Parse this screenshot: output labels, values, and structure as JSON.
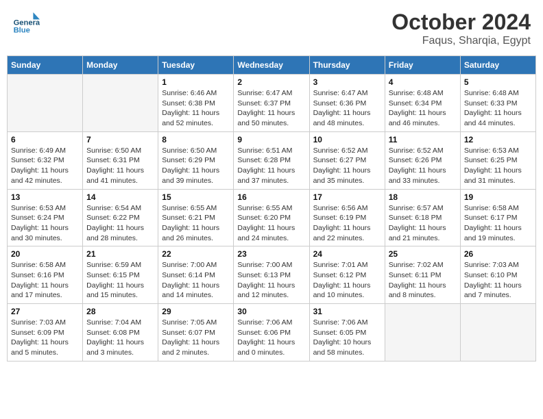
{
  "header": {
    "logo_line1": "General",
    "logo_line2": "Blue",
    "title": "October 2024",
    "subtitle": "Faqus, Sharqia, Egypt"
  },
  "days_of_week": [
    "Sunday",
    "Monday",
    "Tuesday",
    "Wednesday",
    "Thursday",
    "Friday",
    "Saturday"
  ],
  "weeks": [
    [
      {
        "day": "",
        "detail": ""
      },
      {
        "day": "",
        "detail": ""
      },
      {
        "day": "1",
        "detail": "Sunrise: 6:46 AM\nSunset: 6:38 PM\nDaylight: 11 hours\nand 52 minutes."
      },
      {
        "day": "2",
        "detail": "Sunrise: 6:47 AM\nSunset: 6:37 PM\nDaylight: 11 hours\nand 50 minutes."
      },
      {
        "day": "3",
        "detail": "Sunrise: 6:47 AM\nSunset: 6:36 PM\nDaylight: 11 hours\nand 48 minutes."
      },
      {
        "day": "4",
        "detail": "Sunrise: 6:48 AM\nSunset: 6:34 PM\nDaylight: 11 hours\nand 46 minutes."
      },
      {
        "day": "5",
        "detail": "Sunrise: 6:48 AM\nSunset: 6:33 PM\nDaylight: 11 hours\nand 44 minutes."
      }
    ],
    [
      {
        "day": "6",
        "detail": "Sunrise: 6:49 AM\nSunset: 6:32 PM\nDaylight: 11 hours\nand 42 minutes."
      },
      {
        "day": "7",
        "detail": "Sunrise: 6:50 AM\nSunset: 6:31 PM\nDaylight: 11 hours\nand 41 minutes."
      },
      {
        "day": "8",
        "detail": "Sunrise: 6:50 AM\nSunset: 6:29 PM\nDaylight: 11 hours\nand 39 minutes."
      },
      {
        "day": "9",
        "detail": "Sunrise: 6:51 AM\nSunset: 6:28 PM\nDaylight: 11 hours\nand 37 minutes."
      },
      {
        "day": "10",
        "detail": "Sunrise: 6:52 AM\nSunset: 6:27 PM\nDaylight: 11 hours\nand 35 minutes."
      },
      {
        "day": "11",
        "detail": "Sunrise: 6:52 AM\nSunset: 6:26 PM\nDaylight: 11 hours\nand 33 minutes."
      },
      {
        "day": "12",
        "detail": "Sunrise: 6:53 AM\nSunset: 6:25 PM\nDaylight: 11 hours\nand 31 minutes."
      }
    ],
    [
      {
        "day": "13",
        "detail": "Sunrise: 6:53 AM\nSunset: 6:24 PM\nDaylight: 11 hours\nand 30 minutes."
      },
      {
        "day": "14",
        "detail": "Sunrise: 6:54 AM\nSunset: 6:22 PM\nDaylight: 11 hours\nand 28 minutes."
      },
      {
        "day": "15",
        "detail": "Sunrise: 6:55 AM\nSunset: 6:21 PM\nDaylight: 11 hours\nand 26 minutes."
      },
      {
        "day": "16",
        "detail": "Sunrise: 6:55 AM\nSunset: 6:20 PM\nDaylight: 11 hours\nand 24 minutes."
      },
      {
        "day": "17",
        "detail": "Sunrise: 6:56 AM\nSunset: 6:19 PM\nDaylight: 11 hours\nand 22 minutes."
      },
      {
        "day": "18",
        "detail": "Sunrise: 6:57 AM\nSunset: 6:18 PM\nDaylight: 11 hours\nand 21 minutes."
      },
      {
        "day": "19",
        "detail": "Sunrise: 6:58 AM\nSunset: 6:17 PM\nDaylight: 11 hours\nand 19 minutes."
      }
    ],
    [
      {
        "day": "20",
        "detail": "Sunrise: 6:58 AM\nSunset: 6:16 PM\nDaylight: 11 hours\nand 17 minutes."
      },
      {
        "day": "21",
        "detail": "Sunrise: 6:59 AM\nSunset: 6:15 PM\nDaylight: 11 hours\nand 15 minutes."
      },
      {
        "day": "22",
        "detail": "Sunrise: 7:00 AM\nSunset: 6:14 PM\nDaylight: 11 hours\nand 14 minutes."
      },
      {
        "day": "23",
        "detail": "Sunrise: 7:00 AM\nSunset: 6:13 PM\nDaylight: 11 hours\nand 12 minutes."
      },
      {
        "day": "24",
        "detail": "Sunrise: 7:01 AM\nSunset: 6:12 PM\nDaylight: 11 hours\nand 10 minutes."
      },
      {
        "day": "25",
        "detail": "Sunrise: 7:02 AM\nSunset: 6:11 PM\nDaylight: 11 hours\nand 8 minutes."
      },
      {
        "day": "26",
        "detail": "Sunrise: 7:03 AM\nSunset: 6:10 PM\nDaylight: 11 hours\nand 7 minutes."
      }
    ],
    [
      {
        "day": "27",
        "detail": "Sunrise: 7:03 AM\nSunset: 6:09 PM\nDaylight: 11 hours\nand 5 minutes."
      },
      {
        "day": "28",
        "detail": "Sunrise: 7:04 AM\nSunset: 6:08 PM\nDaylight: 11 hours\nand 3 minutes."
      },
      {
        "day": "29",
        "detail": "Sunrise: 7:05 AM\nSunset: 6:07 PM\nDaylight: 11 hours\nand 2 minutes."
      },
      {
        "day": "30",
        "detail": "Sunrise: 7:06 AM\nSunset: 6:06 PM\nDaylight: 11 hours\nand 0 minutes."
      },
      {
        "day": "31",
        "detail": "Sunrise: 7:06 AM\nSunset: 6:05 PM\nDaylight: 10 hours\nand 58 minutes."
      },
      {
        "day": "",
        "detail": ""
      },
      {
        "day": "",
        "detail": ""
      }
    ]
  ]
}
